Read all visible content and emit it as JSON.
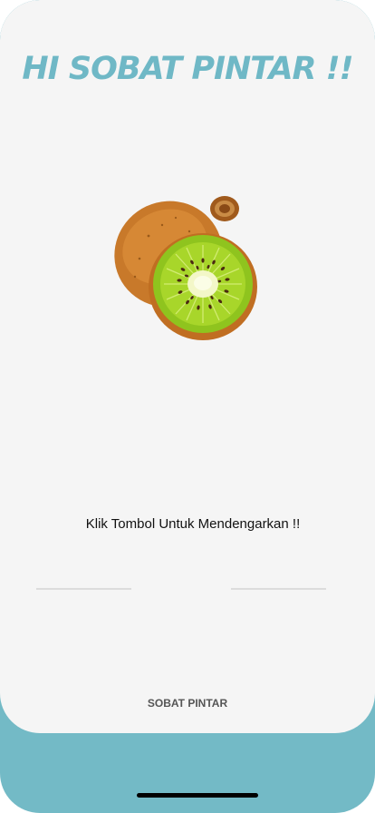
{
  "header": {
    "title": "HI SOBAT PINTAR !!"
  },
  "illustration": {
    "name": "kiwi-fruit"
  },
  "main": {
    "instruction": "Klik Tombol Untuk Mendengarkan !!"
  },
  "footer": {
    "label": "SOBAT PINTAR"
  },
  "colors": {
    "accent": "#6fb8c6",
    "bottom_band": "#73bac6",
    "card_background": "#f5f5f5"
  }
}
